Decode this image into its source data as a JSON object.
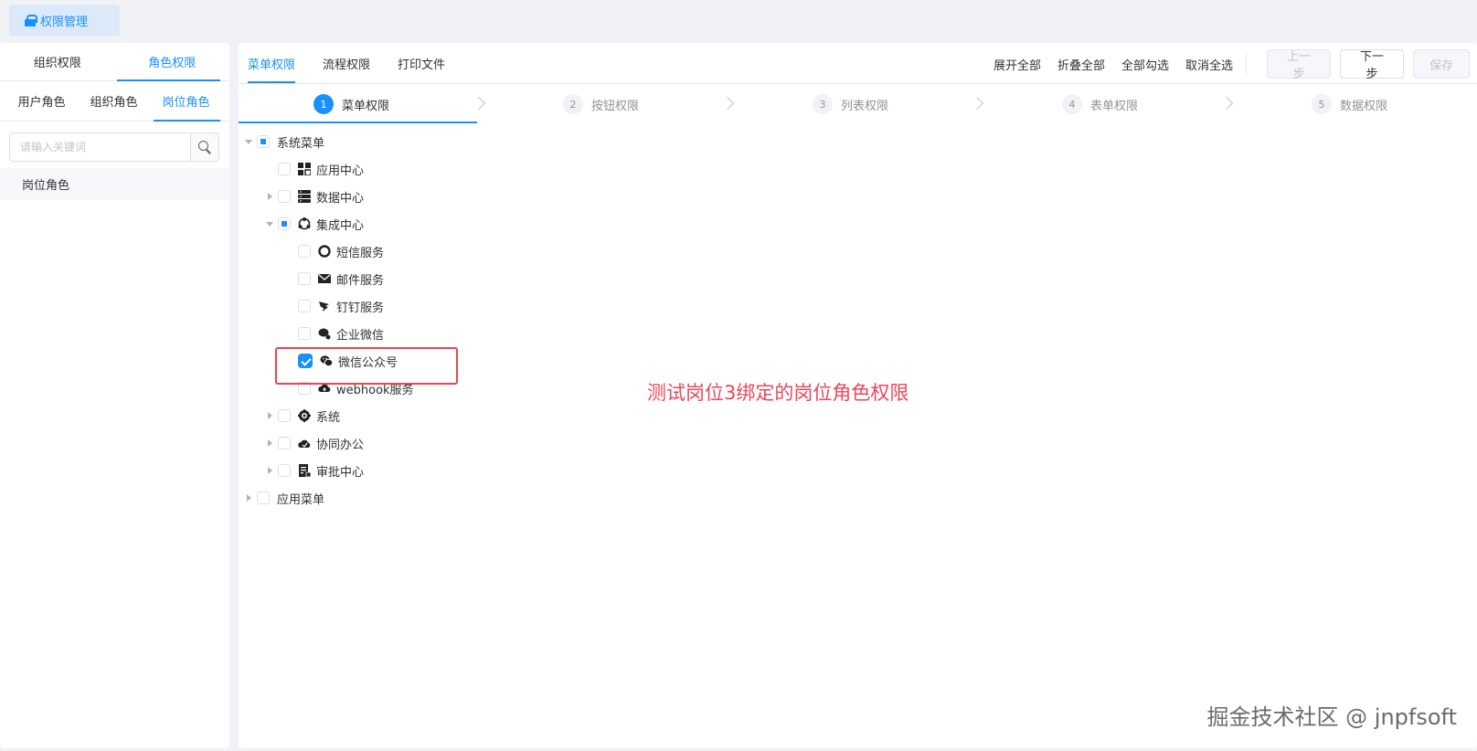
{
  "page_tab": {
    "label": "权限管理",
    "icon": "lock-icon"
  },
  "left": {
    "tabs": [
      {
        "label": "组织权限"
      },
      {
        "label": "角色权限",
        "active": true
      }
    ],
    "sub_tabs": [
      {
        "label": "用户角色"
      },
      {
        "label": "组织角色"
      },
      {
        "label": "岗位角色",
        "active": true
      }
    ],
    "search": {
      "placeholder": "请输入关键词",
      "value": ""
    },
    "roles": [
      "岗位角色"
    ]
  },
  "main": {
    "tabs": [
      {
        "label": "菜单权限",
        "active": true
      },
      {
        "label": "流程权限"
      },
      {
        "label": "打印文件"
      }
    ],
    "toolbar": {
      "expand_all": "展开全部",
      "collapse_all": "折叠全部",
      "check_all": "全部勾选",
      "uncheck_all": "取消全选",
      "prev": "上一步",
      "next": "下一步",
      "save": "保存"
    },
    "steps": [
      {
        "num": "1",
        "label": "菜单权限",
        "active": true
      },
      {
        "num": "2",
        "label": "按钮权限"
      },
      {
        "num": "3",
        "label": "列表权限"
      },
      {
        "num": "4",
        "label": "表单权限"
      },
      {
        "num": "5",
        "label": "数据权限"
      }
    ],
    "tree": {
      "system_menu": "系统菜单",
      "app_center": "应用中心",
      "data_center": "数据中心",
      "integration_center": "集成中心",
      "sms_service": "短信服务",
      "mail_service": "邮件服务",
      "dingtalk_service": "钉钉服务",
      "wecom": "企业微信",
      "wechat_official": "微信公众号",
      "webhook_service": "webhook服务",
      "system": "系统",
      "collab_office": "协同办公",
      "approval_center": "审批中心",
      "app_menu": "应用菜单"
    }
  },
  "annotation": "测试岗位3绑定的岗位角色权限",
  "watermark": "掘金技术社区 @ jnpfsoft",
  "colors": {
    "accent": "#1890ff",
    "annotation": "#e9475b"
  }
}
